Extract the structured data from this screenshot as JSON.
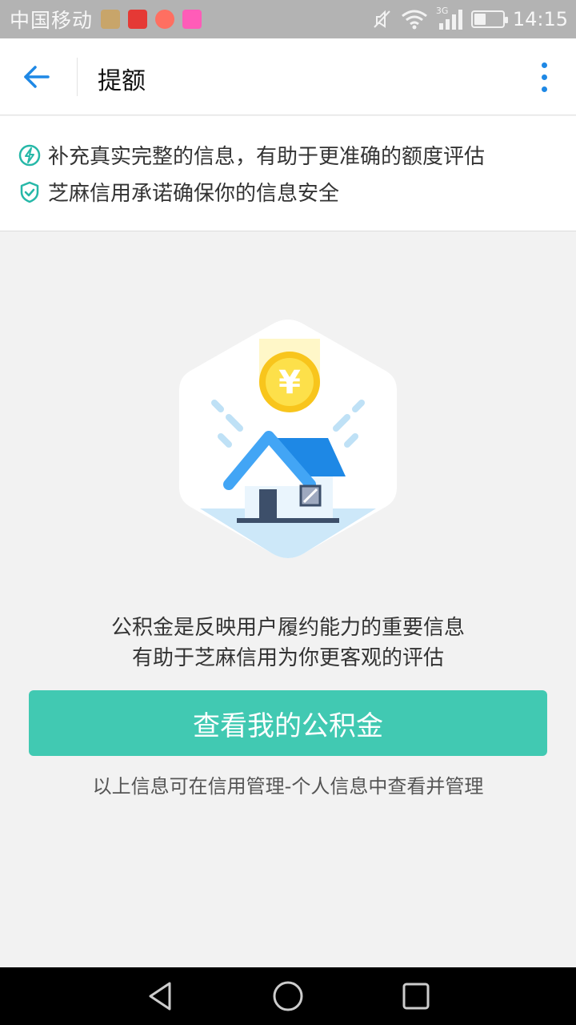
{
  "status_bar": {
    "carrier": "中国移动",
    "network": "3G",
    "time": "14:15"
  },
  "app_bar": {
    "title": "提额"
  },
  "info": {
    "line1": "补充真实完整的信息，有助于更准确的额度评估",
    "line2": "芝麻信用承诺确保你的信息安全"
  },
  "main": {
    "desc_line1": "公积金是反映用户履约能力的重要信息",
    "desc_line2": "有助于芝麻信用为你更客观的评估",
    "button_label": "查看我的公积金",
    "note": "以上信息可在信用管理-个人信息中查看并管理"
  },
  "colors": {
    "accent": "#41c9b2",
    "link_blue": "#1e88e5"
  },
  "icons": {
    "info1": "lightning-icon",
    "info2": "shield-check-icon"
  }
}
